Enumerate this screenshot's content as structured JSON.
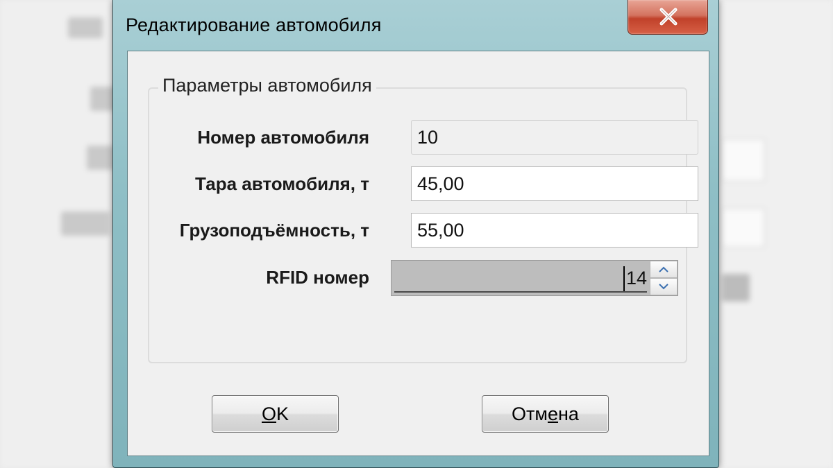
{
  "dialog": {
    "title": "Редактирование автомобиля",
    "close_icon": "close-icon"
  },
  "group": {
    "legend": "Параметры автомобиля"
  },
  "fields": {
    "car_number": {
      "label": "Номер автомобиля",
      "value": "10",
      "readonly": true
    },
    "tare": {
      "label": "Тара автомобиля, т",
      "value": "45,00"
    },
    "capacity": {
      "label": "Грузоподъёмность, т",
      "value": "55,00"
    },
    "rfid": {
      "label": "RFID номер",
      "value": "14"
    }
  },
  "buttons": {
    "ok": {
      "mnemonic": "O",
      "rest": "K"
    },
    "cancel": {
      "before": "Отм",
      "mnemonic": "е",
      "after": "на"
    }
  },
  "colors": {
    "frame": "#8fbfc6",
    "close_button": "#c0412a",
    "client_background": "#f0f0f0"
  }
}
